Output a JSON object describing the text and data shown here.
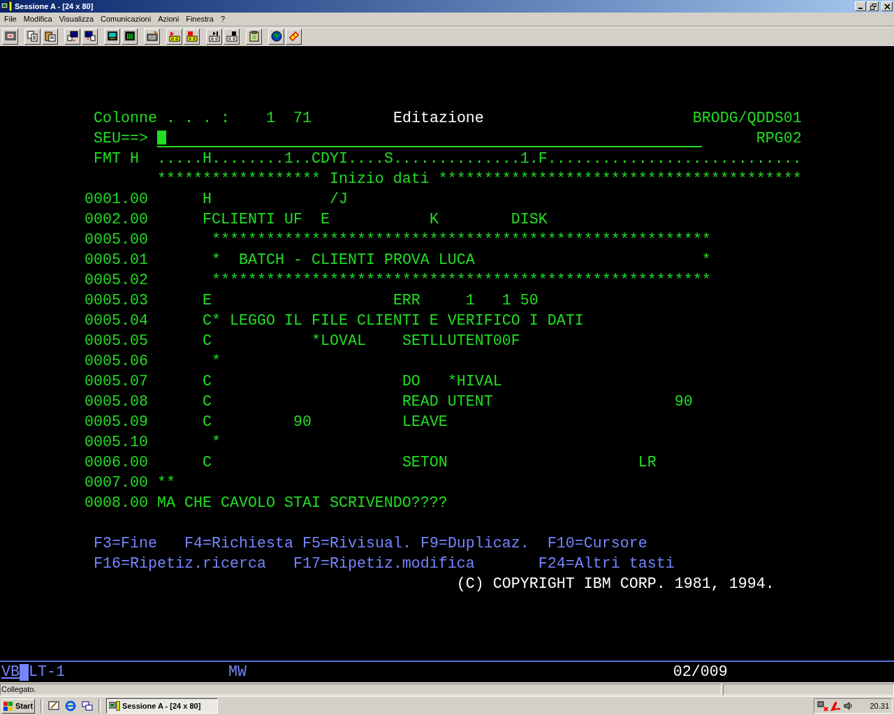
{
  "window": {
    "title": "Sessione A - [24 x 80]"
  },
  "menu": [
    "File",
    "Modifica",
    "Visualizza",
    "Comunicazioni",
    "Azioni",
    "Finestra",
    "?"
  ],
  "terminal": {
    "header_line": [
      {
        "text": "  Colonne . . . :",
        "kind": "label"
      },
      {
        "text": "    1",
        "kind": "label"
      },
      {
        "text": "  71",
        "kind": "label"
      },
      {
        "text": "         Editazione",
        "kind": "title"
      },
      {
        "text": "                       BRODG/QDDS01",
        "kind": "label"
      }
    ],
    "command_line": {
      "prompt": "  SEU==>",
      "member": "      RPG02"
    },
    "format_line": [
      "  FMT H",
      "  .....H........1..CDYI....S..............1.F............................"
    ],
    "start_marker": "         ****************** Inizio dati ****************************************",
    "source_lines": [
      {
        "seq": "0001.00",
        "segments": [
          "      H",
          "             /J"
        ]
      },
      {
        "seq": "0002.00",
        "segments": [
          "      FCLIENTI UF",
          "  E",
          "           K",
          "        DISK"
        ]
      },
      {
        "seq": "0005.00",
        "segments": [
          "       *******************************************************"
        ]
      },
      {
        "seq": "0005.01",
        "segments": [
          "       *",
          "  BATCH - CLIENTI PROVA LUCA",
          "                         *"
        ]
      },
      {
        "seq": "0005.02",
        "segments": [
          "       *******************************************************"
        ]
      },
      {
        "seq": "0005.03",
        "segments": [
          "      E",
          "                    ERR",
          "     1",
          "   1 50"
        ]
      },
      {
        "seq": "0005.04",
        "segments": [
          "      C* LEGGO IL FILE CLIENTI E VERIFICO I DATI"
        ]
      },
      {
        "seq": "0005.05",
        "segments": [
          "      C",
          "           *LOVAL",
          "    SETLLUTENT00F"
        ]
      },
      {
        "seq": "0005.06",
        "segments": [
          "       *"
        ]
      },
      {
        "seq": "0005.07",
        "segments": [
          "      C",
          "                     DO",
          "   *HIVAL"
        ]
      },
      {
        "seq": "0005.08",
        "segments": [
          "      C",
          "                     READ UTENT",
          "                    90"
        ]
      },
      {
        "seq": "0005.09",
        "segments": [
          "      C",
          "         90",
          "          LEAVE"
        ]
      },
      {
        "seq": "0005.10",
        "segments": [
          "       *"
        ]
      },
      {
        "seq": "0006.00",
        "segments": [
          "      C",
          "                     SETON",
          "                     LR"
        ]
      },
      {
        "seq": "0007.00",
        "segments": [
          " **"
        ]
      },
      {
        "seq": "0008.00",
        "segments": [
          " MA CHE CAVOLO STAI SCRIVENDO????"
        ]
      }
    ],
    "function_keys": [
      [
        "  F3=Fine",
        "   F4=Richiesta",
        " F5=Rivisual.",
        " F9=Duplicaz.",
        "  F10=Cursore"
      ],
      [
        "  F16=Ripetiz.ricerca",
        "   F17=Ripetiz.modifica",
        "       F24=Altri tasti"
      ]
    ],
    "copyright": "                                          (C) COPYRIGHT IBM CORP. 1981, 1994."
  },
  "operator_info": {
    "indicators": [
      "VB",
      "LT-1",
      "MW"
    ],
    "cursor_position": "02/009"
  },
  "status_bar": {
    "text": "Collegato."
  },
  "taskbar": {
    "start": "Start",
    "tasks": [
      {
        "label": "Sessione A - [24 x 80]",
        "selected": true
      }
    ],
    "clock": "20.31"
  }
}
